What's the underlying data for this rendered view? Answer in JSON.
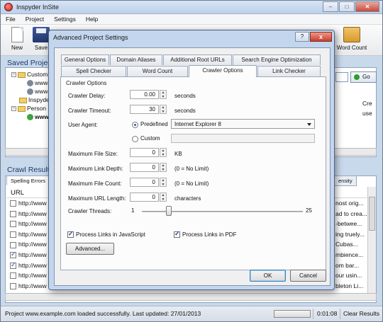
{
  "app": {
    "title": "Inspyder InSite"
  },
  "menu": [
    "File",
    "Project",
    "Settings",
    "Help"
  ],
  "toolbar": {
    "new_label": "New",
    "save_label": "Save",
    "wordcount_label": "Word Count"
  },
  "saved_projects": {
    "title": "Saved Projec",
    "rows": [
      {
        "label": "Custom"
      },
      {
        "label": "www"
      },
      {
        "label": "www"
      },
      {
        "label": "Inspyde"
      },
      {
        "label": "Person"
      },
      {
        "label": "www"
      }
    ],
    "right_header": "Cre",
    "right_cell": "use"
  },
  "go_button": "Go",
  "crawl": {
    "title": "Crawl Result",
    "tab_spelling": "Spelling Errors",
    "tab_right": "ensity",
    "url_header": "URL",
    "rows": [
      {
        "url": "http://www",
        "checked": false,
        "right": "nost orig..."
      },
      {
        "url": "http://www",
        "checked": false,
        "right": "ad to crea..."
      },
      {
        "url": "http://www",
        "checked": false,
        "right": "-betwee..."
      },
      {
        "url": "http://www",
        "checked": false,
        "right": "ing truely..."
      },
      {
        "url": "http://www",
        "checked": false,
        "right": "Cubas..."
      },
      {
        "url": "http://www",
        "checked": true,
        "right": "mbience..."
      },
      {
        "url": "http://www",
        "checked": true,
        "right": "om bar..."
      },
      {
        "url": "http://www",
        "checked": false,
        "right": "our usin..."
      },
      {
        "url": "http://www",
        "checked": false,
        "right": "bleton Li..."
      }
    ]
  },
  "status": {
    "text": "Project www.example.com loaded successfully. Last updated: 27/01/2013",
    "time": "0:01:08",
    "clear": "Clear Results"
  },
  "dialog": {
    "title": "Advanced Project Settings",
    "help": "?",
    "close": "x",
    "tabs_row1": [
      "General Options",
      "Domain Aliases",
      "Additional Root URLs",
      "Search Engine Optimization"
    ],
    "tabs_row2": [
      "Spell Checker",
      "Word Count",
      "Crawler Options",
      "Link Checker"
    ],
    "group": "Crawler Options",
    "crawl_delay": {
      "label": "Crawler Delay:",
      "value": "0.00",
      "unit": "seconds"
    },
    "crawl_timeout": {
      "label": "Crawler Timeout:",
      "value": "30",
      "unit": "seconds"
    },
    "user_agent": {
      "label": "User Agent:",
      "predefined_label": "Predefined",
      "predefined_value": "Internet Explorer 8",
      "custom_label": "Custom",
      "selected": "predefined"
    },
    "max_file_size": {
      "label": "Maximum File Size:",
      "value": "0",
      "unit": "KB"
    },
    "max_link_depth": {
      "label": "Maximum Link Depth:",
      "value": "0",
      "unit": "(0 = No Limit)"
    },
    "max_file_count": {
      "label": "Maximum File Count:",
      "value": "0",
      "unit": "(0 = No Limit)"
    },
    "max_url_length": {
      "label": "Maximum URL Length:",
      "value": "0",
      "unit": "characters"
    },
    "threads": {
      "label": "Crawler Threads:",
      "min": "1",
      "max": "25",
      "value": 5
    },
    "process_js": {
      "label": "Process Links in JavaScript",
      "checked": true
    },
    "process_pdf": {
      "label": "Process Links in PDF",
      "checked": true
    },
    "advanced_button": "Advanced...",
    "ok_button": "OK",
    "cancel_button": "Cancel"
  },
  "colors": {
    "accent": "#2b55c7",
    "frame": "#c3d6ee"
  }
}
